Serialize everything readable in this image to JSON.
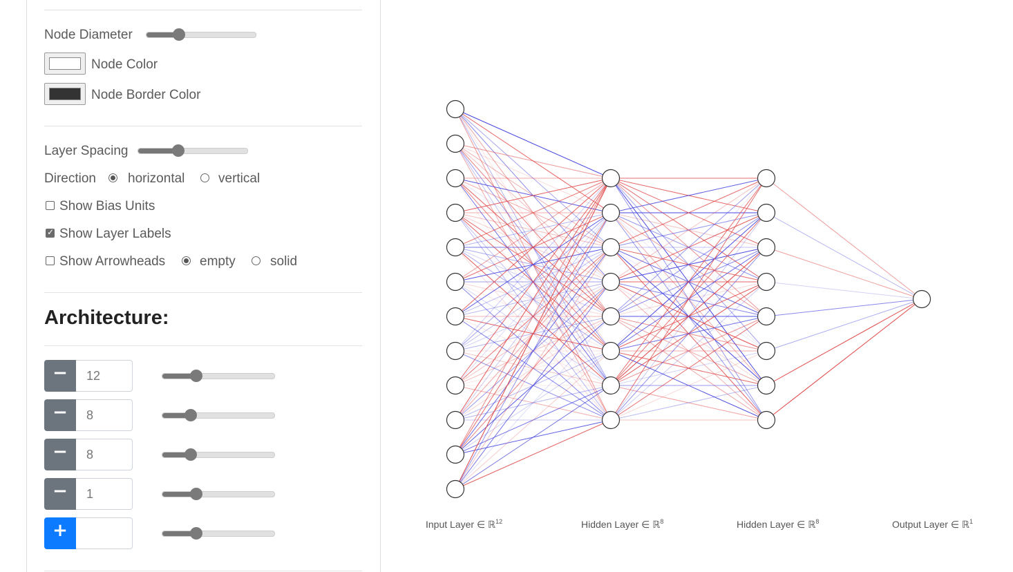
{
  "style": {
    "node_diameter_label": "Node Diameter",
    "node_diameter_value": 0.3,
    "node_color_label": "Node Color",
    "node_color": "#ffffff",
    "node_border_color_label": "Node Border Color",
    "node_border_color": "#333333",
    "layer_spacing_label": "Layer Spacing",
    "layer_spacing_value": 0.37,
    "direction_label": "Direction",
    "direction_options": [
      "horizontal",
      "vertical"
    ],
    "direction_selected": "horizontal",
    "show_bias_label": "Show Bias Units",
    "show_bias": false,
    "show_layer_labels_label": "Show Layer Labels",
    "show_layer_labels": true,
    "show_arrowheads_label": "Show Arrowheads",
    "show_arrowheads": false,
    "arrowhead_options": [
      "empty",
      "solid"
    ],
    "arrowhead_selected": "empty"
  },
  "architecture": {
    "title": "Architecture:",
    "remove_label": "−",
    "add_label": "+",
    "layers": [
      {
        "units": "12",
        "slider": 0.3
      },
      {
        "units": "8",
        "slider": 0.25
      },
      {
        "units": "8",
        "slider": 0.25
      },
      {
        "units": "1",
        "slider": 0.3
      }
    ],
    "new_layer": {
      "units": "",
      "slider": 0.3
    }
  },
  "network": {
    "layers": [
      {
        "label": "Input Layer ∈ ℝ",
        "sup": "12",
        "units": 12
      },
      {
        "label": "Hidden Layer ∈ ℝ",
        "sup": "8",
        "units": 8
      },
      {
        "label": "Hidden Layer ∈ ℝ",
        "sup": "8",
        "units": 8
      },
      {
        "label": "Output Layer ∈ ℝ",
        "sup": "1",
        "units": 1
      }
    ],
    "positive_color": "#e04444",
    "negative_color": "#4444e0"
  }
}
